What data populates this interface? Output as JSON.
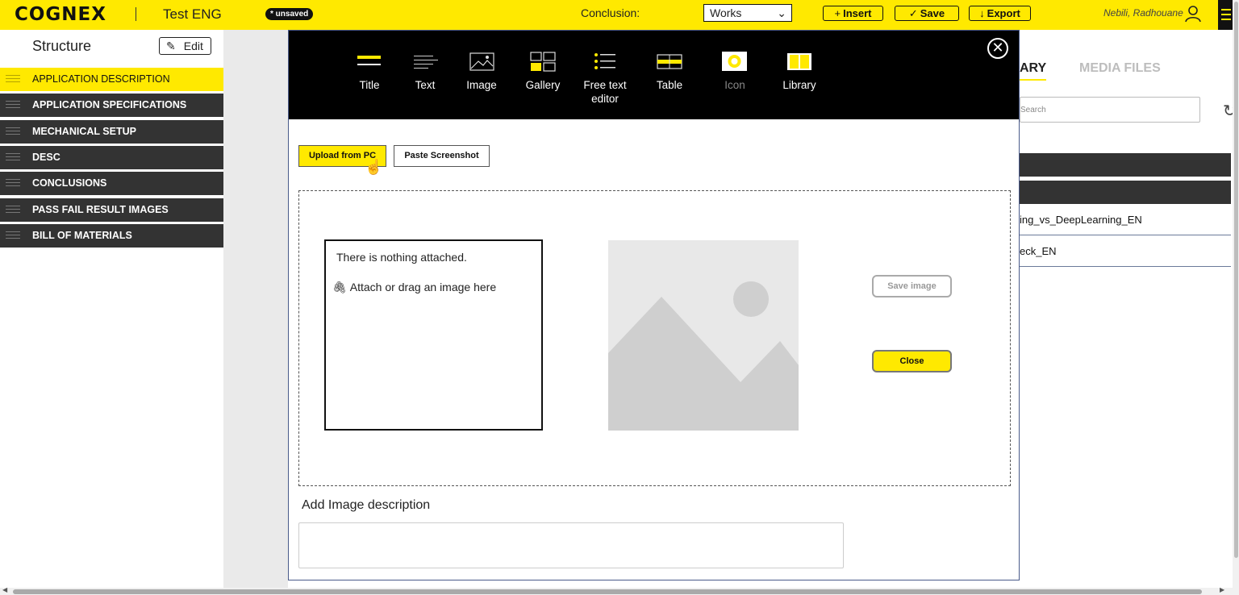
{
  "topbar": {
    "logo": "COGNEX",
    "doc_title": "Test ENG",
    "unsaved_badge": "* unsaved",
    "conclusion_label": "Conclusion:",
    "conclusion_value": "Works",
    "insert_label": "Insert",
    "save_label": "Save",
    "export_label": "Export",
    "user_name": "Nebili, Radhouane"
  },
  "sidebar": {
    "title": "Structure",
    "edit_label": "Edit",
    "items": [
      {
        "label": "APPLICATION DESCRIPTION",
        "active": true
      },
      {
        "label": "APPLICATION SPECIFICATIONS",
        "active": false
      },
      {
        "label": "MECHANICAL SETUP",
        "active": false
      },
      {
        "label": "DESC",
        "active": false
      },
      {
        "label": "CONCLUSIONS",
        "active": false
      },
      {
        "label": "PASS FAIL RESULT IMAGES",
        "active": false
      },
      {
        "label": "BILL OF MATERIALS",
        "active": false
      }
    ]
  },
  "right_panel": {
    "tab_library_partial": "ARY",
    "tab_media": "MEDIA FILES",
    "search_placeholder": "Search",
    "rows": [
      "ing_vs_DeepLearning_EN",
      "eck_EN"
    ]
  },
  "modal": {
    "tools": [
      {
        "label": "Title",
        "icon": "title-icon"
      },
      {
        "label": "Text",
        "icon": "text-icon"
      },
      {
        "label": "Image",
        "icon": "image-icon"
      },
      {
        "label": "Gallery",
        "icon": "gallery-icon"
      },
      {
        "label": "Free text editor",
        "icon": "list-icon"
      },
      {
        "label": "Table",
        "icon": "table-icon"
      },
      {
        "label": "Icon",
        "icon": "icon-icon"
      },
      {
        "label": "Library",
        "icon": "library-icon"
      }
    ],
    "upload_label": "Upload from PC",
    "paste_label": "Paste Screenshot",
    "nothing_attached": "There is nothing attached.",
    "attach_hint": "Attach or drag an image here",
    "save_image_label": "Save image",
    "close_label": "Close",
    "description_label": "Add Image description"
  },
  "colors": {
    "accent": "#ffe900",
    "dark": "#333333",
    "toolbar": "#000000"
  }
}
